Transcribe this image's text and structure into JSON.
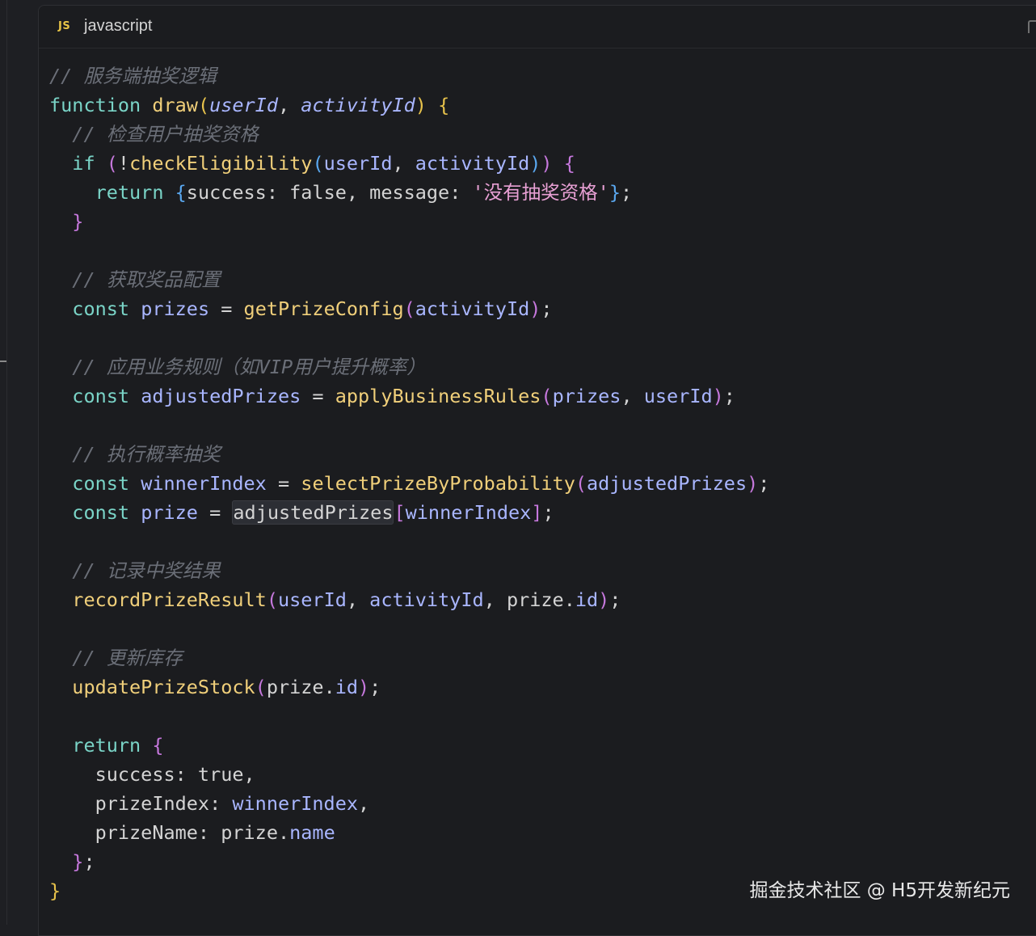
{
  "header": {
    "icon": "js-icon",
    "icon_text": "JS",
    "language": "javascript"
  },
  "code": {
    "lines": [
      [
        [
          "cm",
          "// 服务端抽奖逻辑"
        ]
      ],
      [
        [
          "kw",
          "function"
        ],
        [
          "pl",
          " "
        ],
        [
          "fn",
          "draw"
        ],
        [
          "b1",
          "("
        ],
        [
          "pr",
          "userId"
        ],
        [
          "pl",
          ", "
        ],
        [
          "pr",
          "activityId"
        ],
        [
          "b1",
          ")"
        ],
        [
          "pl",
          " "
        ],
        [
          "b1",
          "{"
        ]
      ],
      [
        [
          "pl",
          "  "
        ],
        [
          "cm",
          "// 检查用户抽奖资格"
        ]
      ],
      [
        [
          "pl",
          "  "
        ],
        [
          "kw",
          "if"
        ],
        [
          "pl",
          " "
        ],
        [
          "b2",
          "("
        ],
        [
          "pl",
          "!"
        ],
        [
          "fn",
          "checkEligibility"
        ],
        [
          "b3",
          "("
        ],
        [
          "vr",
          "userId"
        ],
        [
          "pl",
          ", "
        ],
        [
          "vr",
          "activityId"
        ],
        [
          "b3",
          ")"
        ],
        [
          "b2",
          ")"
        ],
        [
          "pl",
          " "
        ],
        [
          "b2",
          "{"
        ]
      ],
      [
        [
          "pl",
          "    "
        ],
        [
          "kw",
          "return"
        ],
        [
          "pl",
          " "
        ],
        [
          "b3",
          "{"
        ],
        [
          "pl",
          "success: false, message: "
        ],
        [
          "st",
          "'没有抽奖资格'"
        ],
        [
          "b3",
          "}"
        ],
        [
          "pl",
          ";"
        ]
      ],
      [
        [
          "pl",
          "  "
        ],
        [
          "b2",
          "}"
        ]
      ],
      [],
      [
        [
          "pl",
          "  "
        ],
        [
          "cm",
          "// 获取奖品配置"
        ]
      ],
      [
        [
          "pl",
          "  "
        ],
        [
          "kw",
          "const"
        ],
        [
          "pl",
          " "
        ],
        [
          "vr",
          "prizes"
        ],
        [
          "pl",
          " = "
        ],
        [
          "fn",
          "getPrizeConfig"
        ],
        [
          "b2",
          "("
        ],
        [
          "vr",
          "activityId"
        ],
        [
          "b2",
          ")"
        ],
        [
          "pl",
          ";"
        ]
      ],
      [],
      [
        [
          "pl",
          "  "
        ],
        [
          "cm",
          "// 应用业务规则（如VIP用户提升概率）"
        ]
      ],
      [
        [
          "pl",
          "  "
        ],
        [
          "kw",
          "const"
        ],
        [
          "pl",
          " "
        ],
        [
          "vr",
          "adjustedPrizes"
        ],
        [
          "pl",
          " = "
        ],
        [
          "fn",
          "applyBusinessRules"
        ],
        [
          "b2",
          "("
        ],
        [
          "vr",
          "prizes"
        ],
        [
          "pl",
          ", "
        ],
        [
          "vr",
          "userId"
        ],
        [
          "b2",
          ")"
        ],
        [
          "pl",
          ";"
        ]
      ],
      [],
      [
        [
          "pl",
          "  "
        ],
        [
          "cm",
          "// 执行概率抽奖"
        ]
      ],
      [
        [
          "pl",
          "  "
        ],
        [
          "kw",
          "const"
        ],
        [
          "pl",
          " "
        ],
        [
          "vr",
          "winnerIndex"
        ],
        [
          "pl",
          " = "
        ],
        [
          "fn",
          "selectPrizeByProbability"
        ],
        [
          "b2",
          "("
        ],
        [
          "vr",
          "adjustedPrizes"
        ],
        [
          "b2",
          ")"
        ],
        [
          "pl",
          ";"
        ]
      ],
      [
        [
          "pl",
          "  "
        ],
        [
          "kw",
          "const"
        ],
        [
          "pl",
          " "
        ],
        [
          "vr",
          "prize"
        ],
        [
          "pl",
          " = "
        ],
        [
          "hl",
          "adjustedPrizes"
        ],
        [
          "b2",
          "["
        ],
        [
          "vr",
          "winnerIndex"
        ],
        [
          "b2",
          "]"
        ],
        [
          "pl",
          ";"
        ]
      ],
      [],
      [
        [
          "pl",
          "  "
        ],
        [
          "cm",
          "// 记录中奖结果"
        ]
      ],
      [
        [
          "pl",
          "  "
        ],
        [
          "fn",
          "recordPrizeResult"
        ],
        [
          "b2",
          "("
        ],
        [
          "vr",
          "userId"
        ],
        [
          "pl",
          ", "
        ],
        [
          "vr",
          "activityId"
        ],
        [
          "pl",
          ", prize."
        ],
        [
          "vr",
          "id"
        ],
        [
          "b2",
          ")"
        ],
        [
          "pl",
          ";"
        ]
      ],
      [],
      [
        [
          "pl",
          "  "
        ],
        [
          "cm",
          "// 更新库存"
        ]
      ],
      [
        [
          "pl",
          "  "
        ],
        [
          "fn",
          "updatePrizeStock"
        ],
        [
          "b2",
          "("
        ],
        [
          "pl",
          "prize."
        ],
        [
          "vr",
          "id"
        ],
        [
          "b2",
          ")"
        ],
        [
          "pl",
          ";"
        ]
      ],
      [],
      [
        [
          "pl",
          "  "
        ],
        [
          "kw",
          "return"
        ],
        [
          "pl",
          " "
        ],
        [
          "b2",
          "{"
        ]
      ],
      [
        [
          "pl",
          "    success: true,"
        ]
      ],
      [
        [
          "pl",
          "    prizeIndex: "
        ],
        [
          "vr",
          "winnerIndex"
        ],
        [
          "pl",
          ","
        ]
      ],
      [
        [
          "pl",
          "    prizeName: prize."
        ],
        [
          "vr",
          "name"
        ]
      ],
      [
        [
          "pl",
          "  "
        ],
        [
          "b2",
          "}"
        ],
        [
          "pl",
          ";"
        ]
      ],
      [
        [
          "b1",
          "}"
        ]
      ]
    ]
  },
  "watermark": "掘金技术社区 @ H5开发新纪元"
}
